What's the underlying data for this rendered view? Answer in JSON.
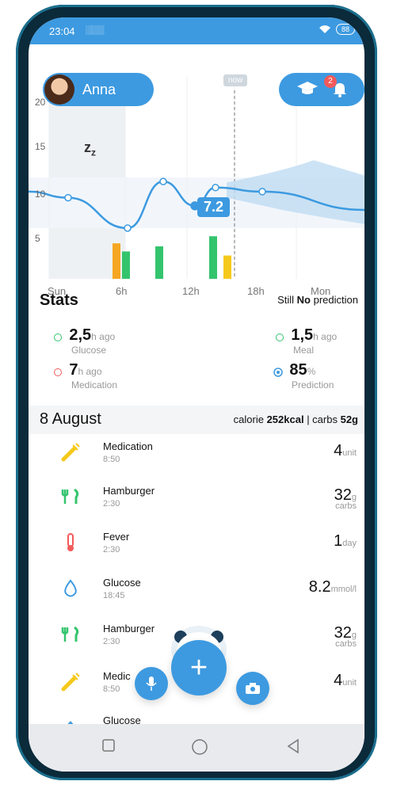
{
  "status": {
    "time": "23:04",
    "signal": "░░░",
    "wifi": "wifi-icon",
    "battery": "88"
  },
  "header": {
    "user_name": "Anna",
    "notifications_count": "2",
    "now_label": "now"
  },
  "chart_data": {
    "type": "line",
    "x": [
      "Sun",
      "6h",
      "12h",
      "18h",
      "Mon"
    ],
    "ylim": [
      0,
      20
    ],
    "y_ticks": [
      5,
      10,
      15,
      20
    ],
    "current_value": "7.2",
    "series": [
      {
        "values": [
          8.6,
          8.0,
          5.0,
          9.6,
          7.2,
          9.0,
          8.6,
          6.8
        ]
      }
    ],
    "bars": [
      {
        "color": "#f5a623",
        "value": 3.5
      },
      {
        "color": "#34c46d",
        "value": 2.7
      },
      {
        "color": "#34c46d",
        "value": 3.2
      },
      {
        "color": "#34c46d",
        "value": 4.2
      },
      {
        "color": "#f5c91b",
        "value": 2.3
      }
    ]
  },
  "stats": {
    "title": "Stats",
    "prediction_prefix": "Still ",
    "prediction_bold": "No",
    "prediction_suffix": " prediction",
    "glucose_value": "2,5",
    "glucose_unit": "h ago",
    "glucose_label": "Glucose",
    "medication_value": "7",
    "medication_unit": "h ago",
    "medication_label": "Medication",
    "meal_value": "1,5",
    "meal_unit": "h ago",
    "meal_label": "Meal",
    "prediction_value": "85",
    "prediction_unit": "%",
    "prediction_label": "Prediction"
  },
  "date_section": {
    "title": "8 August",
    "calorie_label": "calorie ",
    "calorie_value": "252kcal",
    "separator": " | carbs ",
    "carbs_value": "52g"
  },
  "entries": [
    {
      "title": "Medication",
      "sub": "8:50",
      "amount": "4",
      "unit": "unit",
      "unit2": ""
    },
    {
      "title": "Hamburger",
      "sub": "2:30",
      "amount": "32",
      "unit": "g",
      "unit2": "carbs"
    },
    {
      "title": "Fever",
      "sub": "2:30",
      "amount": "1",
      "unit": "day",
      "unit2": ""
    },
    {
      "title": "Glucose",
      "sub": "18:45",
      "amount": "8.2",
      "unit": "mmol/l",
      "unit2": ""
    },
    {
      "title": "Hamburger",
      "sub": "2:30",
      "amount": "32",
      "unit": "g",
      "unit2": "carbs"
    },
    {
      "title": "Medic",
      "sub": "8:50",
      "amount": "4",
      "unit": "unit",
      "unit2": ""
    },
    {
      "title": "Glucose",
      "sub": "",
      "amount": "",
      "unit": "",
      "unit2": ""
    }
  ],
  "colors": {
    "primary": "#3d9ae0",
    "orange": "#f5a623",
    "green": "#34c46d",
    "yellow": "#f5c91b",
    "red": "#f35a5a"
  }
}
